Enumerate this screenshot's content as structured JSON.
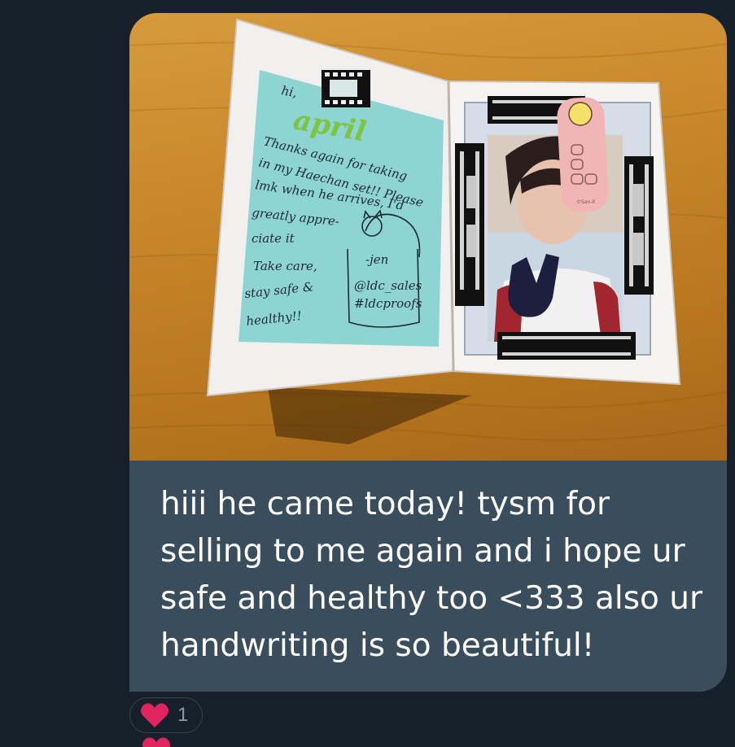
{
  "message": {
    "text": "hiii he came today! tysm for selling to me again and i hope ur safe and healthy too <333 also ur handwriting is so beautiful!"
  },
  "photo": {
    "note_lines": [
      "hi,",
      "april",
      "Thanks again for taking",
      "in my Haechan set!! Please",
      "lmk when he arrives, I'd",
      "greatly appre-",
      "ciate it",
      "Take care,",
      "-jen",
      "stay safe &",
      "@ldc_sales",
      "healthy!!",
      "#ldcproofs"
    ],
    "bookmark_label": "©San-X"
  },
  "reaction": {
    "icon": "heart-icon",
    "count": "1"
  },
  "colors": {
    "background": "#15202b",
    "bubble": "#3a4d5c",
    "heart": "#e0245e"
  }
}
